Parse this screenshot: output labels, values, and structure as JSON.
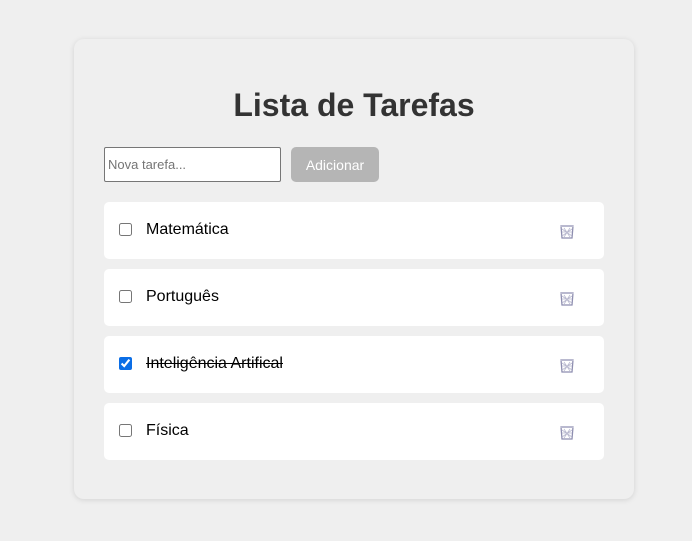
{
  "header": {
    "title": "Lista de Tarefas"
  },
  "form": {
    "input_placeholder": "Nova tarefa...",
    "input_value": "",
    "add_label": "Adicionar"
  },
  "tasks": [
    {
      "label": "Matemática",
      "done": false,
      "delete_icon": "trash-icon"
    },
    {
      "label": "Português",
      "done": false,
      "delete_icon": "trash-icon"
    },
    {
      "label": "Inteligência Artifical",
      "done": true,
      "delete_icon": "trash-icon"
    },
    {
      "label": "Física",
      "done": false,
      "delete_icon": "trash-icon"
    }
  ],
  "colors": {
    "background": "#efefef",
    "card": "#efefef",
    "task_bg": "#ffffff",
    "button_bg": "#b5b5b5",
    "button_text": "#ffffff",
    "title": "#333333",
    "checkbox_accent": "#0b6ee6",
    "trash_icon": "#8e8eb0"
  }
}
